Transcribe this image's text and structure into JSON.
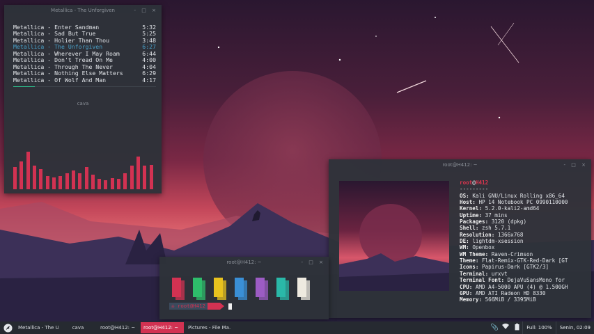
{
  "music_window": {
    "title": "Metallica - The Unforgiven",
    "buttons": "- □ ×",
    "tracks": [
      {
        "name": "Metallica - Enter Sandman",
        "time": "5:32",
        "active": false
      },
      {
        "name": "Metallica - Sad But True",
        "time": "5:25",
        "active": false
      },
      {
        "name": "Metallica - Holier Than Thou",
        "time": "3:48",
        "active": false
      },
      {
        "name": "Metallica - The Unforgiven",
        "time": "6:27",
        "active": true
      },
      {
        "name": "Metallica - Wherever I May Roam",
        "time": "6:44",
        "active": false
      },
      {
        "name": "Metallica - Don't Tread On Me",
        "time": "4:00",
        "active": false
      },
      {
        "name": "Metallica - Through The Never",
        "time": "4:04",
        "active": false
      },
      {
        "name": "Metallica - Nothing Else Matters",
        "time": "6:29",
        "active": false
      },
      {
        "name": "Metallica - Of Wolf And Man",
        "time": "4:17",
        "active": false
      }
    ],
    "progress": 0.15,
    "cava_title": "cava",
    "cava_levels": [
      0.5,
      0.62,
      0.83,
      0.52,
      0.45,
      0.29,
      0.26,
      0.3,
      0.35,
      0.42,
      0.35,
      0.49,
      0.33,
      0.23,
      0.2,
      0.25,
      0.23,
      0.35,
      0.52,
      0.72,
      0.52,
      0.54
    ]
  },
  "neofetch_window": {
    "title": "root@H412: ~",
    "buttons": "- □ ×",
    "user": "root",
    "at": "@",
    "host": "H412",
    "separator": "---------",
    "info": [
      {
        "key": "OS",
        "value": "Kali GNU/Linux Rolling x86_64"
      },
      {
        "key": "Host",
        "value": "HP 14 Notebook PC 0990110000"
      },
      {
        "key": "Kernel",
        "value": "5.2.0-kali2-amd64"
      },
      {
        "key": "Uptime",
        "value": "37 mins"
      },
      {
        "key": "Packages",
        "value": "3120 (dpkg)"
      },
      {
        "key": "Shell",
        "value": "zsh 5.7.1"
      },
      {
        "key": "Resolution",
        "value": "1366x768"
      },
      {
        "key": "DE",
        "value": "lightdm-xsession"
      },
      {
        "key": "WM",
        "value": "Openbox"
      },
      {
        "key": "WM Theme",
        "value": "Raven-Crimson"
      },
      {
        "key": "Theme",
        "value": "Flat-Remix-GTK-Red-Dark [GT"
      },
      {
        "key": "Icons",
        "value": "Papirus-Dark [GTK2/3]"
      },
      {
        "key": "Terminal",
        "value": "urxvt"
      },
      {
        "key": "Terminal Font",
        "value": "DejaVuSansMono for"
      },
      {
        "key": "CPU",
        "value": "AMD A4-5000 APU (4) @ 1.500GH"
      },
      {
        "key": "GPU",
        "value": "AMD ATI Radeon HD 8330"
      },
      {
        "key": "Memory",
        "value": "566MiB / 3395MiB"
      }
    ]
  },
  "terminal_window": {
    "title": "root@H412: ~",
    "buttons": "- □ ×",
    "prompt_path": "root@H412",
    "prompt_icon": "☠",
    "palette_colors": [
      "#d23252",
      "#2ebd6b",
      "#e8c21e",
      "#3a8fd6",
      "#9c5cc4",
      "#2ab8a8",
      "#eeeae0"
    ]
  },
  "taskbar": {
    "tasks": [
      {
        "label": "Metallica - The U...",
        "active": false
      },
      {
        "label": "cava",
        "active": false
      },
      {
        "label": "root@H412: ~",
        "active": false
      },
      {
        "label": "root@H412: ~",
        "active": true
      },
      {
        "label": "Pictures - File Ma...",
        "active": false
      }
    ],
    "battery": "Full: 100%",
    "clock": "Senin, 02:09"
  },
  "colors": {
    "accent": "#d23252",
    "panel": "#2e3239",
    "taskbar": "#262a31"
  }
}
